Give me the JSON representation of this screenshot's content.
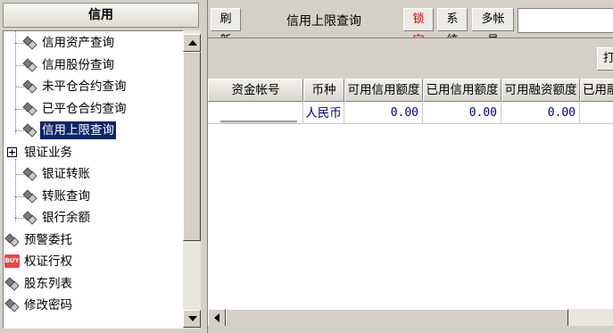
{
  "left_panel": {
    "title": "信用",
    "tree": [
      {
        "label": "信用资产查询",
        "level": 1,
        "icon": "diamond-icon",
        "selected": false
      },
      {
        "label": "信用股份查询",
        "level": 1,
        "icon": "diamond-icon",
        "selected": false
      },
      {
        "label": "未平仓合约查询",
        "level": 1,
        "icon": "diamond-icon",
        "selected": false
      },
      {
        "label": "已平仓合约查询",
        "level": 1,
        "icon": "diamond-icon",
        "selected": false
      },
      {
        "label": "信用上限查询",
        "level": 1,
        "icon": "diamond-icon",
        "selected": true
      },
      {
        "label": "银证业务",
        "level": 0,
        "icon": "plus-expander-icon",
        "selected": false
      },
      {
        "label": "银证转账",
        "level": 1,
        "icon": "diamond-icon",
        "selected": false
      },
      {
        "label": "转账查询",
        "level": 1,
        "icon": "diamond-icon",
        "selected": false
      },
      {
        "label": "银行余额",
        "level": 1,
        "icon": "diamond-icon",
        "selected": false
      },
      {
        "label": "预警委托",
        "level": 0,
        "icon": "diamond-icon",
        "selected": false
      },
      {
        "label": "权证行权",
        "level": 0,
        "icon": "buy-icon",
        "selected": false
      },
      {
        "label": "股东列表",
        "level": 0,
        "icon": "diamond-icon",
        "selected": false
      },
      {
        "label": "修改密码",
        "level": 0,
        "icon": "diamond-icon",
        "selected": false
      }
    ],
    "buy_icon_text": "BUY"
  },
  "toolbar": {
    "refresh_label": "刷新",
    "title": "信用上限查询",
    "lock_label": "锁定",
    "system_label": "系统",
    "multi_account_label": "多帐号",
    "search_value": ""
  },
  "subbar": {
    "button_label": "打"
  },
  "table": {
    "columns": [
      "资金帐号",
      "币种",
      "可用信用额度",
      "已用信用额度",
      "可用融资额度",
      "已用融"
    ],
    "rows": [
      {
        "account": "",
        "currency": "人民币",
        "avail_credit": "0.00",
        "used_credit": "0.00",
        "avail_financing": "0.00",
        "used_financing": ""
      }
    ]
  },
  "colors": {
    "selected_bg": "#0a246a",
    "lock_text": "#d40000",
    "number_text": "#000080"
  }
}
